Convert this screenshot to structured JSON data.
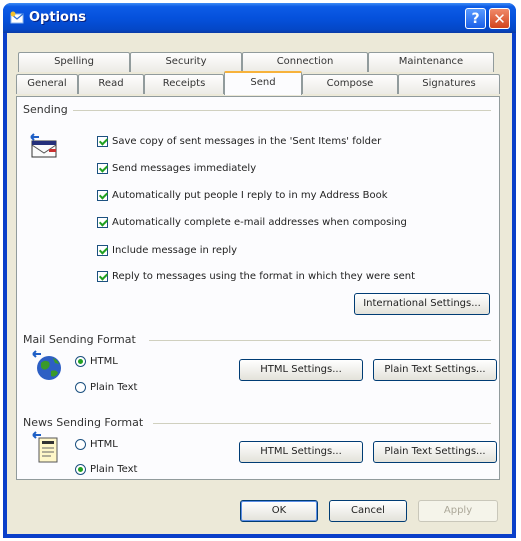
{
  "window": {
    "title": "Options"
  },
  "tabs": {
    "back_row": [
      "Spelling",
      "Security",
      "Connection",
      "Maintenance"
    ],
    "front_row": [
      "General",
      "Read",
      "Receipts",
      "Send",
      "Compose",
      "Signatures"
    ],
    "active": "Send"
  },
  "sending": {
    "label": "Sending",
    "options": [
      {
        "label": "Save copy of sent messages in the 'Sent Items' folder",
        "checked": true
      },
      {
        "label": "Send messages immediately",
        "checked": true
      },
      {
        "label": "Automatically put people I reply to in my Address Book",
        "checked": true
      },
      {
        "label": "Automatically complete e-mail addresses when composing",
        "checked": true
      },
      {
        "label": "Include message in reply",
        "checked": true
      },
      {
        "label": "Reply to messages using the format in which they were sent",
        "checked": true
      }
    ],
    "international_button": "International Settings..."
  },
  "mail_format": {
    "label": "Mail Sending Format",
    "html_label": "HTML",
    "plain_label": "Plain Text",
    "selected": "HTML",
    "html_settings": "HTML Settings...",
    "plain_settings": "Plain Text Settings..."
  },
  "news_format": {
    "label": "News Sending Format",
    "html_label": "HTML",
    "plain_label": "Plain Text",
    "selected": "Plain Text",
    "html_settings": "HTML Settings...",
    "plain_settings": "Plain Text Settings..."
  },
  "footer": {
    "ok": "OK",
    "cancel": "Cancel",
    "apply": "Apply"
  },
  "icons": [
    "outlook-icon",
    "help-icon",
    "close-icon",
    "send-mail-icon",
    "globe-icon",
    "news-document-icon"
  ],
  "colors": {
    "titlebar": "#0551dc",
    "client": "#ece9d8",
    "check": "#21a121",
    "active_tab": "#f7b23b"
  }
}
